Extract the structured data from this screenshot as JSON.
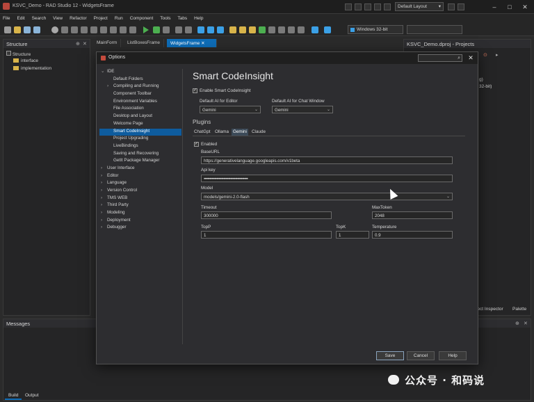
{
  "window": {
    "title": "KSVC_Demo - RAD Studio 12 - WidgetsFrame",
    "layout": "Default Layout"
  },
  "menu": [
    "File",
    "Edit",
    "Search",
    "View",
    "Refactor",
    "Project",
    "Run",
    "Component",
    "Tools",
    "Tabs",
    "Help"
  ],
  "toolbar": {
    "platform": "Windows 32-bit"
  },
  "structure": {
    "title": "Structure",
    "root": "Structure",
    "items": [
      "interface",
      "implementation"
    ]
  },
  "doc_tabs": [
    "MainForm",
    "ListBoxesFrame",
    "WidgetsFrame"
  ],
  "projects": {
    "title": "KSVC_Demo.dproj - Projects",
    "frag1": "g)",
    "frag2": "32-bit)",
    "bottom_tabs": [
      "ject Inspector",
      "Palette"
    ]
  },
  "messages": {
    "title": "Messages",
    "tabs": [
      "Build",
      "Output"
    ]
  },
  "dialog": {
    "title": "Options",
    "tree": [
      {
        "label": "IDE",
        "level": 0,
        "exp": "⌄"
      },
      {
        "label": "Default Folders",
        "level": 1,
        "exp": ""
      },
      {
        "label": "Compiling and Running",
        "level": 1,
        "exp": "›"
      },
      {
        "label": "Component Toolbar",
        "level": 1,
        "exp": ""
      },
      {
        "label": "Environment Variables",
        "level": 1,
        "exp": ""
      },
      {
        "label": "File Association",
        "level": 1,
        "exp": ""
      },
      {
        "label": "Desktop and Layout",
        "level": 1,
        "exp": ""
      },
      {
        "label": "Welcome Page",
        "level": 1,
        "exp": ""
      },
      {
        "label": "Smart CodeInsight",
        "level": 1,
        "exp": "",
        "selected": true
      },
      {
        "label": "Project Upgrading",
        "level": 1,
        "exp": ""
      },
      {
        "label": "LiveBindings",
        "level": 1,
        "exp": ""
      },
      {
        "label": "Saving and Recovering",
        "level": 1,
        "exp": ""
      },
      {
        "label": "GetIt Package Manager",
        "level": 1,
        "exp": ""
      },
      {
        "label": "User Interface",
        "level": 0,
        "exp": "›"
      },
      {
        "label": "Editor",
        "level": 0,
        "exp": "›"
      },
      {
        "label": "Language",
        "level": 0,
        "exp": "›"
      },
      {
        "label": "Version Control",
        "level": 0,
        "exp": "›"
      },
      {
        "label": "TMS WEB",
        "level": 0,
        "exp": "›"
      },
      {
        "label": "Third Party",
        "level": 0,
        "exp": "›"
      },
      {
        "label": "Modeling",
        "level": 0,
        "exp": "›"
      },
      {
        "label": "Deployment",
        "level": 0,
        "exp": "›"
      },
      {
        "label": "Debugger",
        "level": 0,
        "exp": "›"
      }
    ],
    "heading": "Smart CodeInsight",
    "enable_label": "Enable Smart CodeInsight",
    "enable_checked": true,
    "editor_ai_label": "Default AI for Editor",
    "editor_ai_value": "Gemini",
    "chat_ai_label": "Default AI for Chat Window",
    "chat_ai_value": "Gemini",
    "plugins_label": "Plugins",
    "plugin_tabs": [
      "ChatGpt",
      "Ollama",
      "Gemini",
      "Claude"
    ],
    "active_plugin": "Gemini",
    "enabled_label": "Enabled",
    "enabled_checked": true,
    "baseurl_label": "BaseURL",
    "baseurl_value": "https://generativelanguage.googleapis.com/v1beta",
    "apikey_label": "Api key",
    "apikey_value": "••••••••••••••••••••••••••••••••••••••",
    "model_label": "Model",
    "model_value": "models/gemini-2.0-flash",
    "timeout_label": "Timeout",
    "timeout_value": "300000",
    "maxtoken_label": "MaxToken",
    "maxtoken_value": "2048",
    "topp_label": "TopP",
    "topp_value": "1",
    "topk_label": "TopK",
    "topk_value": "1",
    "temperature_label": "Temperature",
    "temperature_value": "0.9",
    "save": "Save",
    "cancel": "Cancel",
    "help": "Help"
  },
  "watermark": "公众号 · 和码说",
  "colors": {
    "accent": "#0e6db8",
    "selection": "#0e5c9e",
    "folder": "#d8b44a"
  }
}
